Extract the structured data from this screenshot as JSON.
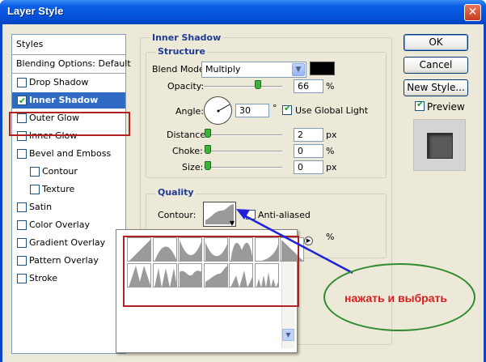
{
  "window": {
    "title": "Layer Style",
    "close_glyph": "✕"
  },
  "styles_list": {
    "header": "Styles",
    "blending": "Blending Options: Default",
    "items": [
      {
        "label": "Drop Shadow",
        "checked": false
      },
      {
        "label": "Inner Shadow",
        "checked": true
      },
      {
        "label": "Outer Glow",
        "checked": false
      },
      {
        "label": "Inner Glow",
        "checked": false
      },
      {
        "label": "Bevel and Emboss",
        "checked": false
      },
      {
        "label": "Contour",
        "checked": false
      },
      {
        "label": "Texture",
        "checked": false
      },
      {
        "label": "Satin",
        "checked": false
      },
      {
        "label": "Color Overlay",
        "checked": false
      },
      {
        "label": "Gradient Overlay",
        "checked": false
      },
      {
        "label": "Pattern Overlay",
        "checked": false
      },
      {
        "label": "Stroke",
        "checked": false
      }
    ]
  },
  "inner_shadow": {
    "section_title": "Inner Shadow",
    "structure": {
      "title": "Structure",
      "blend_mode_label": "Blend Mode:",
      "blend_mode_value": "Multiply",
      "blend_color": "#000000",
      "opacity_label": "Opacity:",
      "opacity_value": "66",
      "opacity_unit": "%",
      "angle_label": "Angle:",
      "angle_value": "30",
      "angle_unit": "°",
      "use_global_light_label": "Use Global Light",
      "use_global_light": true,
      "distance_label": "Distance:",
      "distance_value": "2",
      "distance_unit": "px",
      "choke_label": "Choke:",
      "choke_value": "0",
      "choke_unit": "%",
      "size_label": "Size:",
      "size_value": "0",
      "size_unit": "px"
    },
    "quality": {
      "title": "Quality",
      "contour_label": "Contour:",
      "anti_aliased_label": "Anti-aliased",
      "anti_aliased": false,
      "noise_unit": "%"
    }
  },
  "buttons": {
    "ok": "OK",
    "cancel": "Cancel",
    "new_style": "New Style...",
    "preview_label": "Preview",
    "preview": true
  },
  "annotation": {
    "text": "нажать и выбрать",
    "arrow_color": "#1e22d8",
    "ellipse_color": "#2e8b2e",
    "box_color": "#b22222"
  }
}
